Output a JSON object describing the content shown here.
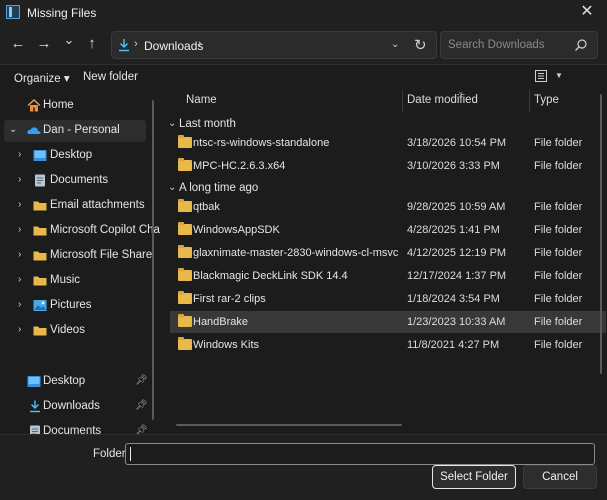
{
  "window": {
    "title": "Missing Files",
    "close_glyph": "✕"
  },
  "nav": {
    "back_glyph": "←",
    "forward_glyph": "→",
    "recent_glyph": "⌄",
    "up_glyph": "↑",
    "breadcrumb": [
      "Downloads"
    ],
    "refresh_glyph": "↻",
    "search_placeholder": "Search Downloads"
  },
  "commands": {
    "organize": "Organize ▾",
    "new_folder": "New folder"
  },
  "sidebar": {
    "items": [
      {
        "label": "Home",
        "icon": "home-icon"
      },
      {
        "label": "Dan - Personal",
        "icon": "onedrive-icon",
        "expanded": true,
        "selected": true
      },
      {
        "label": "Desktop",
        "icon": "desktop-folder-icon"
      },
      {
        "label": "Documents",
        "icon": "documents-folder-icon"
      },
      {
        "label": "Email attachments",
        "icon": "folder-icon"
      },
      {
        "label": "Microsoft Copilot Chat",
        "icon": "folder-icon"
      },
      {
        "label": "Microsoft File Share",
        "icon": "folder-icon"
      },
      {
        "label": "Music",
        "icon": "folder-icon"
      },
      {
        "label": "Pictures",
        "icon": "pictures-folder-icon"
      },
      {
        "label": "Videos",
        "icon": "folder-icon"
      }
    ],
    "quick_access": [
      {
        "label": "Desktop",
        "icon": "desktop-folder-icon"
      },
      {
        "label": "Downloads",
        "icon": "downloads-icon"
      },
      {
        "label": "Documents",
        "icon": "documents-folder-icon"
      }
    ]
  },
  "columns": {
    "name": "Name",
    "date": "Date modified",
    "type": "Type"
  },
  "groups": [
    {
      "label": "Last month",
      "files": [
        {
          "name": "ntsc-rs-windows-standalone",
          "date": "3/18/2026 10:54 PM",
          "type": "File folder"
        },
        {
          "name": "MPC-HC.2.6.3.x64",
          "date": "3/10/2026 3:33 PM",
          "type": "File folder"
        }
      ]
    },
    {
      "label": "A long time ago",
      "files": [
        {
          "name": "qtbak",
          "date": "9/28/2025 10:59 AM",
          "type": "File folder"
        },
        {
          "name": "WindowsAppSDK",
          "date": "4/28/2025 1:41 PM",
          "type": "File folder"
        },
        {
          "name": "glaxnimate-master-2830-windows-cl-msvc2022...",
          "date": "4/12/2025 12:19 PM",
          "type": "File folder"
        },
        {
          "name": "Blackmagic DeckLink SDK 14.4",
          "date": "12/17/2024 1:37 PM",
          "type": "File folder"
        },
        {
          "name": "First rar-2 clips",
          "date": "1/18/2024 3:54 PM",
          "type": "File folder"
        },
        {
          "name": "HandBrake",
          "date": "1/23/2023 10:33 AM",
          "type": "File folder",
          "selected": true
        },
        {
          "name": "Windows Kits",
          "date": "11/8/2021 4:27 PM",
          "type": "File folder"
        }
      ]
    }
  ],
  "footer": {
    "folder_label": "Folder:",
    "folder_value": "",
    "select_button": "Select Folder",
    "cancel_button": "Cancel"
  },
  "colors": {
    "accent": "#4cc2ff",
    "folder": "#e8b84a",
    "background": "#1c1c1c"
  }
}
